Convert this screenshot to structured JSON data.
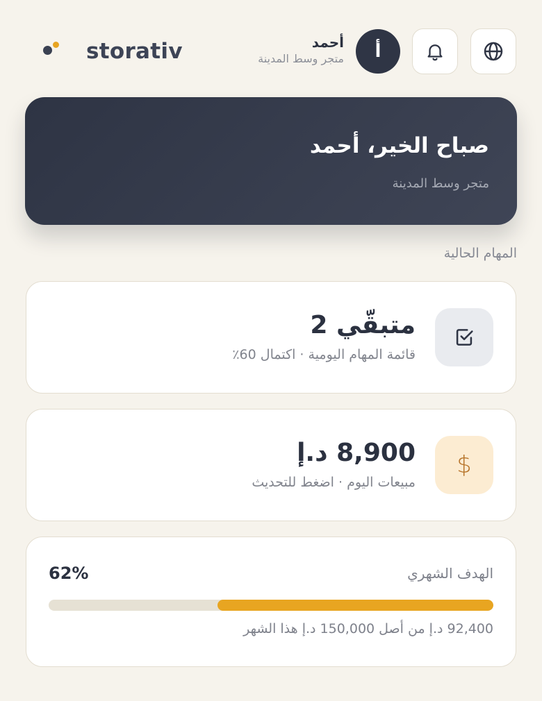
{
  "header": {
    "brand": "storativ",
    "user_name": "أحمد",
    "user_store": "متجر وسط المدينة",
    "avatar_initial": "أ",
    "bell_icon": "bell-icon",
    "globe_icon": "globe-icon"
  },
  "greeting": {
    "title": "صباح الخير، أحمد",
    "subtitle": "متجر وسط المدينة"
  },
  "section_title": "المهام الحالية",
  "cards": {
    "tasks": {
      "icon": "checkbox-icon",
      "value": "متبقّي 2",
      "desc": "قائمة المهام اليومية · اكتمال 60٪"
    },
    "sales": {
      "icon": "dollar-icon",
      "icon_glyph": "$",
      "value": "8,900 د.إ",
      "desc": "مبيعات اليوم · اضغط للتحديث"
    }
  },
  "goal": {
    "label": "الهدف الشهري",
    "percent_text": "62%",
    "progress": 0.62,
    "caption": "92,400 د.إ من أصل 150,000 د.إ هذا الشهر"
  },
  "colors": {
    "background": "#f6f3ec",
    "dark": "#2f3545",
    "accent": "#e8a521"
  }
}
